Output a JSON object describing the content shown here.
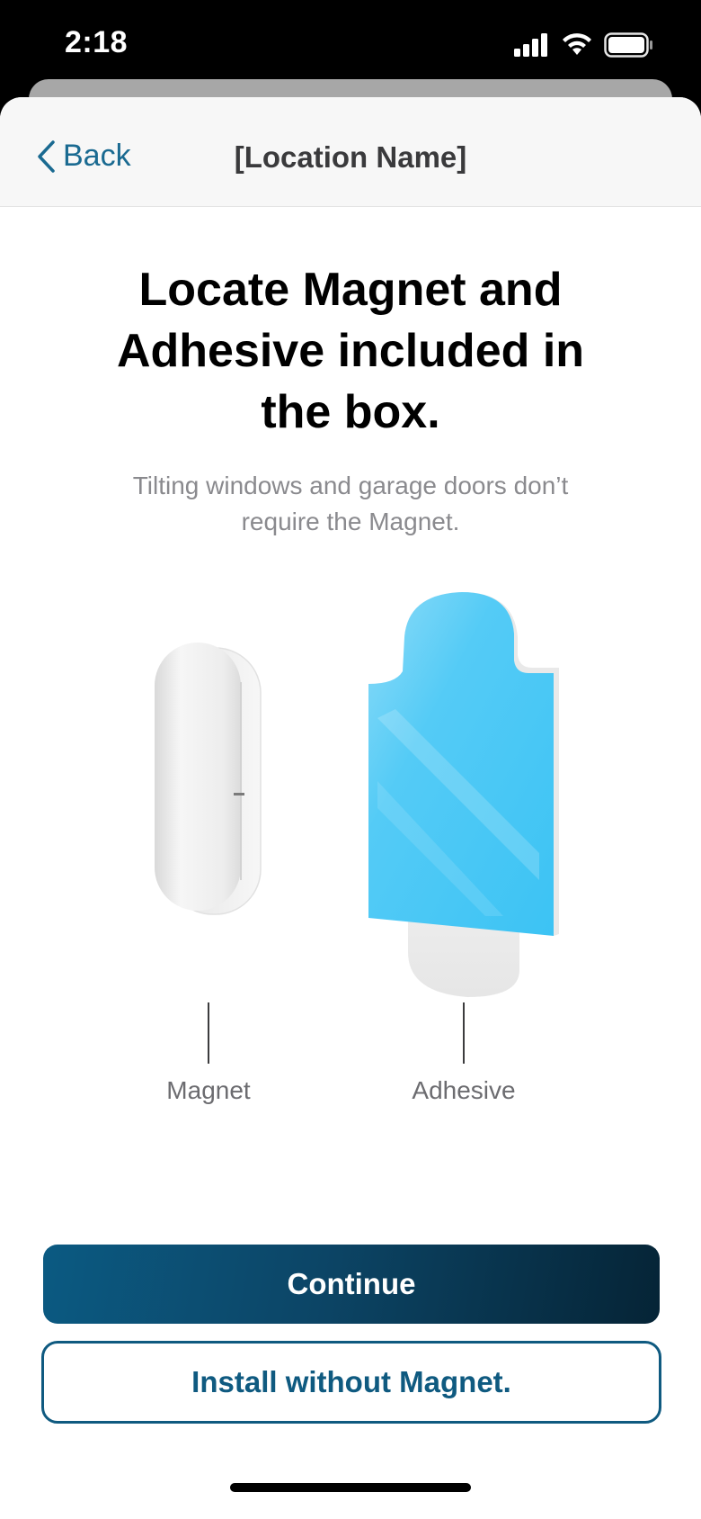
{
  "status_bar": {
    "time": "2:18",
    "icons": [
      "signal-icon",
      "wifi-icon",
      "battery-icon"
    ]
  },
  "nav": {
    "back_label": "Back",
    "title": "[Location Name]"
  },
  "content": {
    "heading_line1": "Locate Magnet and",
    "heading_line2": "Adhesive included in",
    "heading_line3": "the box.",
    "subtext_line1": "Tilting windows and garage doors don’t",
    "subtext_line2": "require the Magnet."
  },
  "illustration": {
    "magnet_label": "Magnet",
    "adhesive_label": "Adhesive"
  },
  "actions": {
    "continue_label": "Continue",
    "install_without_label": "Install without Magnet."
  },
  "colors": {
    "accent": "#1a6a91",
    "button_dark": "#052436",
    "adhesive_blue": "#46c8f5"
  }
}
